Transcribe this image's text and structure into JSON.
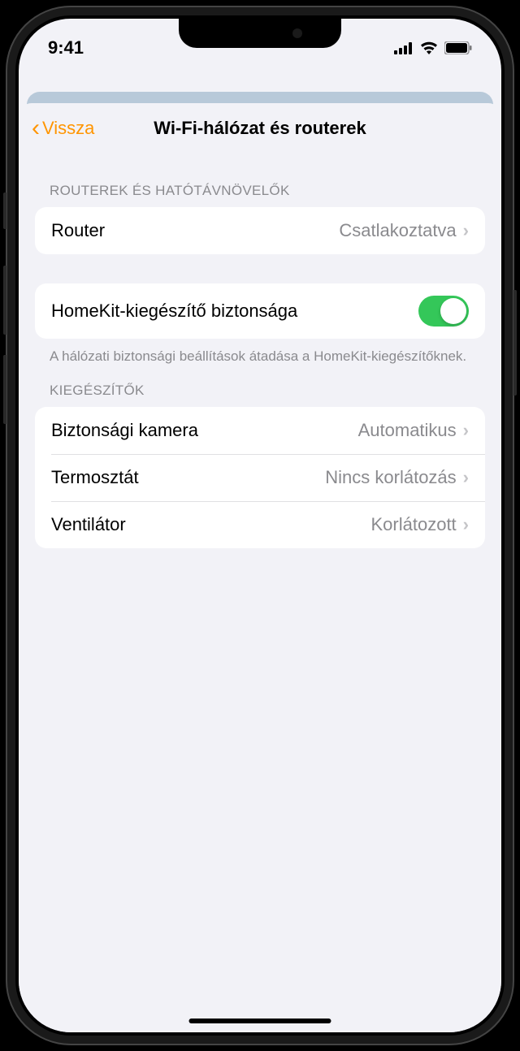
{
  "status": {
    "time": "9:41"
  },
  "nav": {
    "back": "Vissza",
    "title": "Wi-Fi-hálózat és routerek"
  },
  "sections": {
    "routers": {
      "header": "ROUTEREK ÉS HATÓTÁVNÖVELŐK",
      "items": [
        {
          "label": "Router",
          "value": "Csatlakoztatva"
        }
      ]
    },
    "security": {
      "label": "HomeKit-kiegészítő biztonsága",
      "enabled": true,
      "footer": "A hálózati biztonsági beállítások átadása a HomeKit-kiegészítőknek."
    },
    "accessories": {
      "header": "KIEGÉSZÍTŐK",
      "items": [
        {
          "label": "Biztonsági kamera",
          "value": "Automatikus"
        },
        {
          "label": "Termosztát",
          "value": "Nincs korlátozás"
        },
        {
          "label": "Ventilátor",
          "value": "Korlátozott"
        }
      ]
    }
  }
}
